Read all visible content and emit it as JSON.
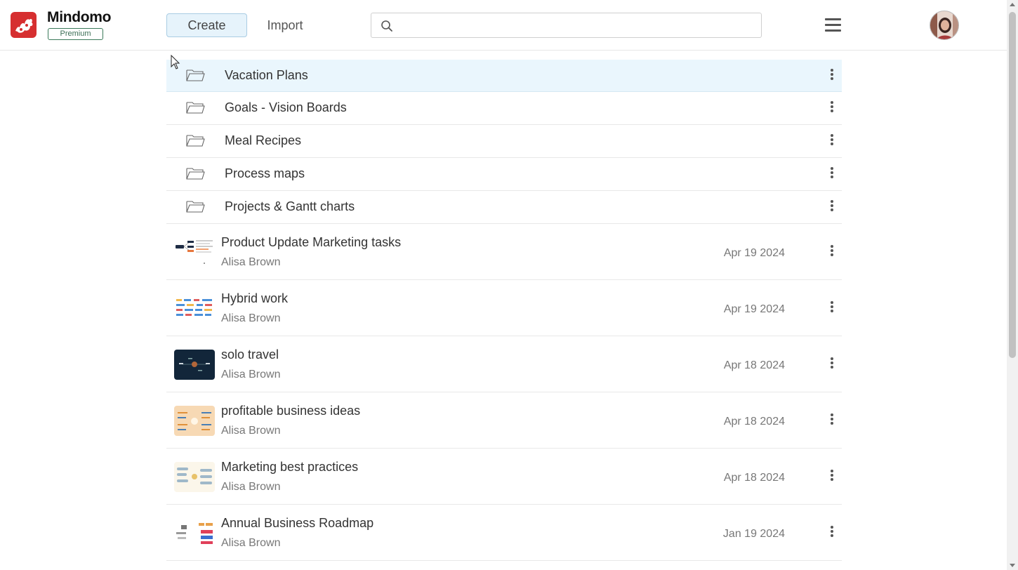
{
  "app": {
    "name": "Mindomo",
    "plan_badge": "Premium",
    "brand_color": "#d62f30"
  },
  "header": {
    "create_label": "Create",
    "import_label": "Import",
    "search_placeholder": ""
  },
  "folders": [
    {
      "name": "Vacation Plans",
      "selected": true
    },
    {
      "name": "Goals - Vision Boards",
      "selected": false
    },
    {
      "name": "Meal Recipes",
      "selected": false
    },
    {
      "name": "Process maps",
      "selected": false
    },
    {
      "name": "Projects & Gantt charts",
      "selected": false
    }
  ],
  "maps": [
    {
      "title": "Product Update Marketing tasks",
      "owner": "Alisa Brown",
      "date": "Apr 19 2024",
      "thumb_bg": "#ffffff"
    },
    {
      "title": "Hybrid work",
      "owner": "Alisa Brown",
      "date": "Apr 19 2024",
      "thumb_bg": "#ffffff"
    },
    {
      "title": "solo travel",
      "owner": "Alisa Brown",
      "date": "Apr 18 2024",
      "thumb_bg": "#12263a"
    },
    {
      "title": "profitable business ideas",
      "owner": "Alisa Brown",
      "date": "Apr 18 2024",
      "thumb_bg": "#f7d9b4"
    },
    {
      "title": "Marketing best practices",
      "owner": "Alisa Brown",
      "date": "Apr 18 2024",
      "thumb_bg": "#fbf6ea"
    },
    {
      "title": "Annual Business Roadmap",
      "owner": "Alisa Brown",
      "date": "Jan 19 2024",
      "thumb_bg": "#ffffff"
    }
  ],
  "icons": {
    "search": "search-icon",
    "menu": "hamburger-menu-icon",
    "folder": "folder-icon",
    "more": "more-vertical-icon"
  }
}
